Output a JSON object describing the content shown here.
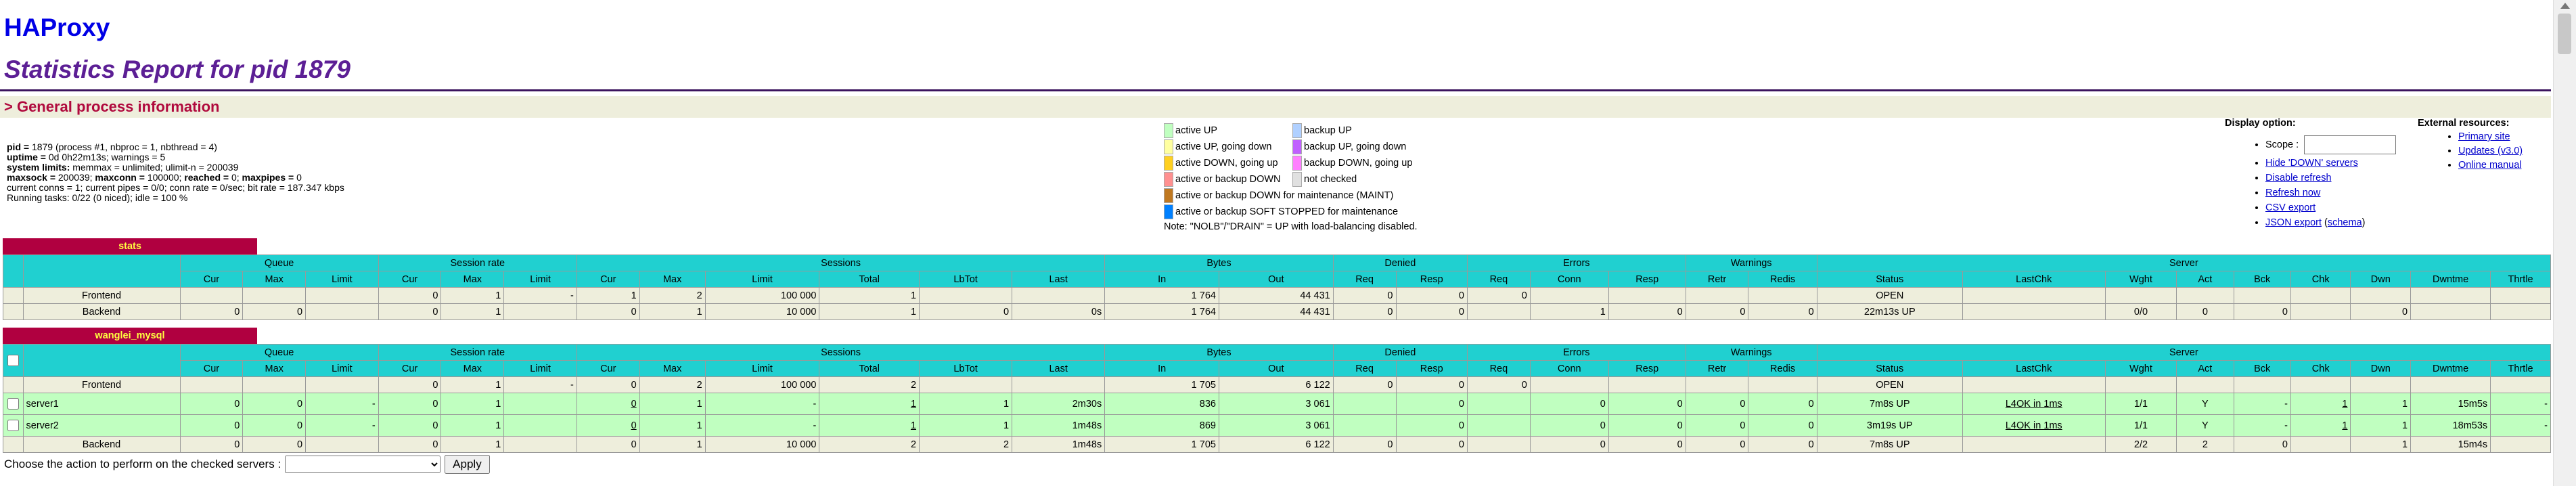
{
  "header": {
    "title": "HAProxy",
    "subtitle": "Statistics Report for pid 1879",
    "section": "> General process information"
  },
  "general_info": {
    "pid_label": "pid = ",
    "pid_value": "1879 (process #1, nbproc = 1, nbthread = 4)",
    "uptime_label": "uptime = ",
    "uptime_value": "0d 0h22m13s; warnings = 5",
    "syslimits_label": "system limits: ",
    "syslimits_value": "memmax = unlimited; ulimit-n = 200039",
    "maxsock_label": "maxsock = ",
    "maxsock_value": "200039; ",
    "maxconn_label": "maxconn = ",
    "maxconn_value": "100000; ",
    "reached_label": "reached = ",
    "reached_value": "0; ",
    "maxpipes_label": "maxpipes = ",
    "maxpipes_value": "0",
    "current_conns": "current conns = 1; current pipes = 0/0; conn rate = 0/sec; bit rate = 187.347 kbps",
    "running_tasks": "Running tasks: 0/22 (0 niced); idle = 100 %"
  },
  "legend": {
    "items": [
      {
        "label": "active UP",
        "color": "#c0ffc0"
      },
      {
        "label": "backup UP",
        "color": "#b0d0ff"
      },
      {
        "label": "active UP, going down",
        "color": "#ffffa0"
      },
      {
        "label": "backup UP, going down",
        "color": "#c060ff"
      },
      {
        "label": "active DOWN, going up",
        "color": "#ffd020"
      },
      {
        "label": "backup DOWN, going up",
        "color": "#ff80ff"
      },
      {
        "label": "active or backup DOWN",
        "color": "#ff9090"
      },
      {
        "label": "not checked",
        "color": "#e0e0e0"
      }
    ],
    "maint": {
      "label": "active or backup DOWN for maintenance (MAINT)",
      "color": "#c07820"
    },
    "soft_stopped": {
      "label": "active or backup SOFT STOPPED for maintenance",
      "color": "#0080ff"
    },
    "note": "Note: \"NOLB\"/\"DRAIN\" = UP with load-balancing disabled."
  },
  "display_options": {
    "heading": "Display option:",
    "scope_label": "Scope :",
    "scope_value": "",
    "hide_down": "Hide 'DOWN' servers",
    "disable_refresh": "Disable refresh",
    "refresh_now": "Refresh now",
    "csv_export": "CSV export",
    "json_export": "JSON export",
    "schema": "schema"
  },
  "external_resources": {
    "heading": "External resources:",
    "primary_site": "Primary site",
    "updates": "Updates (v3.0)",
    "online_manual": "Online manual"
  },
  "columns": {
    "queue": "Queue",
    "session_rate": "Session rate",
    "sessions": "Sessions",
    "bytes": "Bytes",
    "denied": "Denied",
    "errors": "Errors",
    "warnings": "Warnings",
    "server": "Server",
    "cur": "Cur",
    "max": "Max",
    "limit": "Limit",
    "total": "Total",
    "lbtot": "LbTot",
    "last": "Last",
    "in": "In",
    "out": "Out",
    "req": "Req",
    "resp": "Resp",
    "conn": "Conn",
    "retr": "Retr",
    "redis": "Redis",
    "status": "Status",
    "lastchk": "LastChk",
    "wght": "Wght",
    "act": "Act",
    "bck": "Bck",
    "chk": "Chk",
    "dwn": "Dwn",
    "dwntme": "Dwntme",
    "thrtle": "Thrtle"
  },
  "stats": {
    "name": "stats",
    "frontend": {
      "name": "Frontend",
      "q_cur": "",
      "q_max": "",
      "q_limit": "",
      "r_cur": "0",
      "r_max": "1",
      "r_limit": "-",
      "s_cur": "1",
      "s_max": "2",
      "s_limit": "100 000",
      "s_total": "1",
      "lbtot": "",
      "last": "",
      "in": "1 764",
      "out": "44 431",
      "d_req": "0",
      "d_resp": "0",
      "e_req": "0",
      "e_conn": "",
      "e_resp": "",
      "w_retr": "",
      "w_redis": "",
      "status": "OPEN",
      "lastchk": "",
      "wght": "",
      "act": "",
      "bck": "",
      "chk": "",
      "dwn": "",
      "dwntme": "",
      "thrtle": ""
    },
    "backend": {
      "name": "Backend",
      "q_cur": "0",
      "q_max": "0",
      "q_limit": "",
      "r_cur": "0",
      "r_max": "1",
      "r_limit": "",
      "s_cur": "0",
      "s_max": "1",
      "s_limit": "10 000",
      "s_total": "1",
      "lbtot": "0",
      "last": "0s",
      "in": "1 764",
      "out": "44 431",
      "d_req": "0",
      "d_resp": "0",
      "e_req": "",
      "e_conn": "1",
      "e_resp": "0",
      "w_retr": "0",
      "w_redis": "0",
      "status": "22m13s UP",
      "lastchk": "",
      "wght": "0/0",
      "act": "0",
      "bck": "0",
      "chk": "",
      "dwn": "0",
      "dwntme": "",
      "thrtle": ""
    }
  },
  "wanglei_mysql": {
    "name": "wanglei_mysql",
    "frontend": {
      "name": "Frontend",
      "q_cur": "",
      "q_max": "",
      "q_limit": "",
      "r_cur": "0",
      "r_max": "1",
      "r_limit": "-",
      "s_cur": "0",
      "s_max": "2",
      "s_limit": "100 000",
      "s_total": "2",
      "lbtot": "",
      "last": "",
      "in": "1 705",
      "out": "6 122",
      "d_req": "0",
      "d_resp": "0",
      "e_req": "0",
      "e_conn": "",
      "e_resp": "",
      "w_retr": "",
      "w_redis": "",
      "status": "OPEN",
      "lastchk": "",
      "wght": "",
      "act": "",
      "bck": "",
      "chk": "",
      "dwn": "",
      "dwntme": "",
      "thrtle": ""
    },
    "servers": [
      {
        "name": "server1",
        "q_cur": "0",
        "q_max": "0",
        "q_limit": "-",
        "r_cur": "0",
        "r_max": "1",
        "r_limit": "",
        "s_cur": "0",
        "s_max": "1",
        "s_limit": "-",
        "s_total": "1",
        "lbtot": "1",
        "last": "2m30s",
        "in": "836",
        "out": "3 061",
        "d_req": "",
        "d_resp": "0",
        "e_req": "",
        "e_conn": "0",
        "e_resp": "0",
        "w_retr": "0",
        "w_redis": "0",
        "status": "7m8s UP",
        "lastchk": "L4OK in 1ms",
        "wght": "1/1",
        "act": "Y",
        "bck": "-",
        "chk": "1",
        "dwn": "1",
        "dwntme": "15m5s",
        "thrtle": "-"
      },
      {
        "name": "server2",
        "q_cur": "0",
        "q_max": "0",
        "q_limit": "-",
        "r_cur": "0",
        "r_max": "1",
        "r_limit": "",
        "s_cur": "0",
        "s_max": "1",
        "s_limit": "-",
        "s_total": "1",
        "lbtot": "1",
        "last": "1m48s",
        "in": "869",
        "out": "3 061",
        "d_req": "",
        "d_resp": "0",
        "e_req": "",
        "e_conn": "0",
        "e_resp": "0",
        "w_retr": "0",
        "w_redis": "0",
        "status": "3m19s UP",
        "lastchk": "L4OK in 1ms",
        "wght": "1/1",
        "act": "Y",
        "bck": "-",
        "chk": "1",
        "dwn": "1",
        "dwntme": "18m53s",
        "thrtle": "-"
      }
    ],
    "backend": {
      "name": "Backend",
      "q_cur": "0",
      "q_max": "0",
      "q_limit": "",
      "r_cur": "0",
      "r_max": "1",
      "r_limit": "",
      "s_cur": "0",
      "s_max": "1",
      "s_limit": "10 000",
      "s_total": "2",
      "lbtot": "2",
      "last": "1m48s",
      "in": "1 705",
      "out": "6 122",
      "d_req": "0",
      "d_resp": "0",
      "e_req": "",
      "e_conn": "0",
      "e_resp": "0",
      "w_retr": "0",
      "w_redis": "0",
      "status": "7m8s UP",
      "lastchk": "",
      "wght": "2/2",
      "act": "2",
      "bck": "0",
      "chk": "",
      "dwn": "1",
      "dwntme": "15m4s",
      "thrtle": ""
    }
  },
  "action": {
    "label": "Choose the action to perform on the checked servers : ",
    "selected": "",
    "apply": "Apply"
  }
}
